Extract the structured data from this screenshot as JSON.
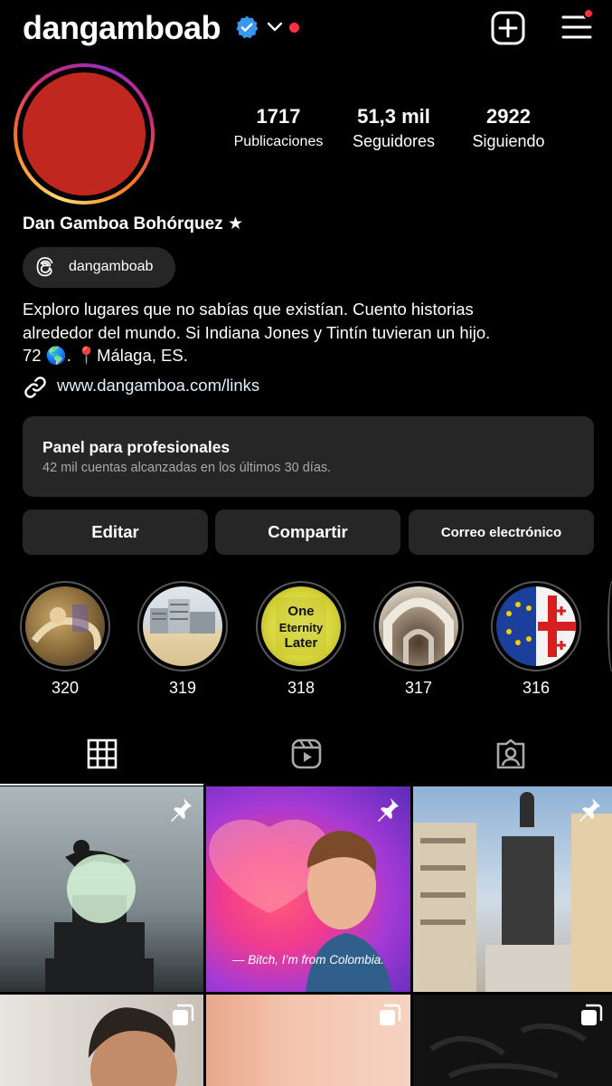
{
  "header": {
    "username": "dangamboab",
    "icons": [
      "verified-badge",
      "chevron-down",
      "notification-dot",
      "new-post-plus",
      "hamburger-menu"
    ],
    "accent_red": "#ff3040",
    "verified_blue": "#3897f0"
  },
  "profile": {
    "avatar_color": "#c0271e",
    "stats": [
      {
        "value": "1717",
        "label": "Publicaciones"
      },
      {
        "value": "51,3 mil",
        "label": "Seguidores"
      },
      {
        "value": "2922",
        "label": "Siguiendo"
      }
    ],
    "full_name": "Dan Gamboa Bohórquez ★",
    "threads_handle": "dangamboab",
    "bio_lines": [
      "Exploro lugares que no sabías que existían. Cuento historias",
      "alrededor del mundo. Si Indiana Jones y Tintín tuvieran un hijo.",
      "72 🌎. 📍Málaga, ES."
    ],
    "link": "www.dangamboa.com/links"
  },
  "professional_panel": {
    "title": "Panel para profesionales",
    "subtitle": "42 mil cuentas alcanzadas en los últimos 30 días."
  },
  "actions": {
    "edit": "Editar",
    "share": "Compartir",
    "email": "Correo electrónico"
  },
  "highlights": [
    {
      "label": "320"
    },
    {
      "label": "319"
    },
    {
      "label": "318",
      "image_text": [
        "One",
        "Eternity",
        "Later"
      ]
    },
    {
      "label": "317"
    },
    {
      "label": "316"
    }
  ],
  "tabs": [
    "grid-icon",
    "reels-icon",
    "tagged-icon"
  ],
  "posts": [
    {
      "pinned": true
    },
    {
      "pinned": true,
      "caption": "— Bitch, I’m from Colombia."
    },
    {
      "pinned": true
    },
    {
      "multi": true
    },
    {
      "multi": true
    },
    {
      "multi": true
    }
  ]
}
